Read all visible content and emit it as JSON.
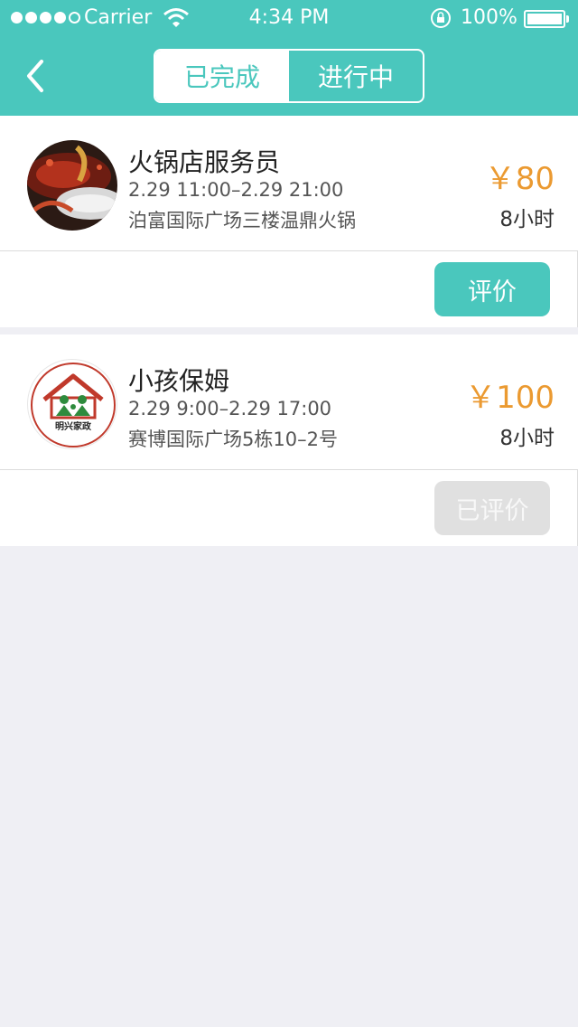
{
  "status_bar": {
    "carrier": "Carrier",
    "time": "4:34 PM",
    "battery": "100%",
    "signal_bars": 4,
    "icons": [
      "signal-icon",
      "wifi-icon",
      "rotation-lock-icon",
      "battery-icon"
    ]
  },
  "header": {
    "back_icon": "chevron-left-icon",
    "tabs": [
      {
        "label": "已完成",
        "active": true
      },
      {
        "label": "进行中",
        "active": false
      }
    ]
  },
  "colors": {
    "accent": "#4ac7bd",
    "price": "#eb9a31",
    "background": "#efeff4",
    "disabled_button": "#e0e0e0"
  },
  "orders": [
    {
      "title": "火锅店服务员",
      "time_range": "2.29 11:00–2.29 21:00",
      "location": "泊富国际广场三楼温鼎火锅",
      "price": "￥80",
      "duration": "8小时",
      "action_label": "评价",
      "action_enabled": true,
      "avatar": "hotpot-photo"
    },
    {
      "title": "小孩保姆",
      "time_range": "2.29 9:00–2.29 17:00",
      "location": "赛博国际广场5栋10–2号",
      "price": "￥100",
      "duration": "8小时",
      "action_label": "已评价",
      "action_enabled": false,
      "avatar": "house-logo",
      "avatar_text": "明兴家政"
    }
  ]
}
